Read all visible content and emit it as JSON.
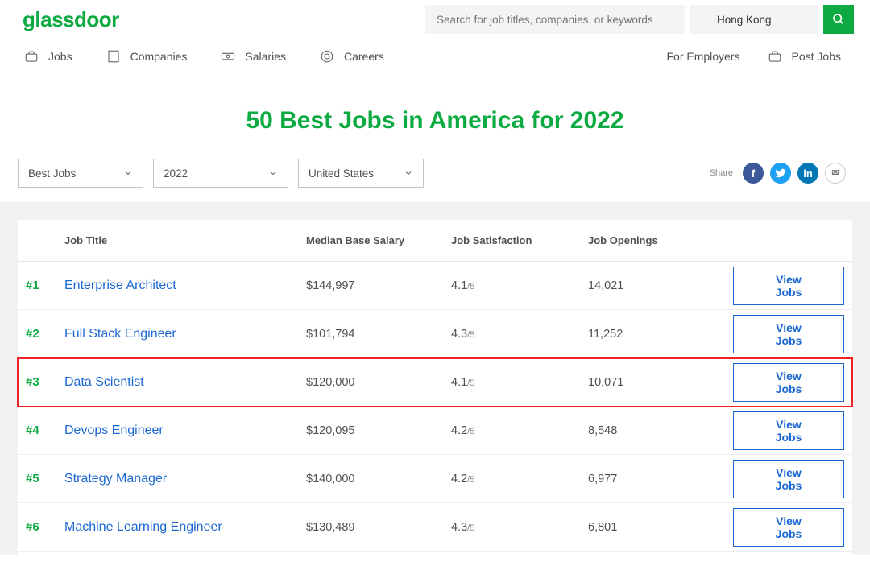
{
  "brand": "glassdoor",
  "search": {
    "placeholder_jobs": "Search for job titles, companies, or keywords",
    "placeholder_location": "",
    "location_value": "Hong Kong"
  },
  "nav": {
    "jobs": "Jobs",
    "companies": "Companies",
    "salaries": "Salaries",
    "careers": "Careers",
    "for_employers": "For Employers",
    "post_jobs": "Post Jobs"
  },
  "page_title": "50 Best Jobs in America for 2022",
  "filters": {
    "type": "Best Jobs",
    "year": "2022",
    "country": "United States"
  },
  "share_label": "Share",
  "table": {
    "headers": {
      "job_title": "Job Title",
      "salary": "Median Base Salary",
      "satisfaction": "Job Satisfaction",
      "openings": "Job Openings"
    },
    "view_jobs_label": "View Jobs",
    "sat_denominator": "/5",
    "rows": [
      {
        "rank": "#1",
        "title": "Enterprise Architect",
        "salary": "$144,997",
        "sat": "4.1",
        "openings": "14,021",
        "highlight": false
      },
      {
        "rank": "#2",
        "title": "Full Stack Engineer",
        "salary": "$101,794",
        "sat": "4.3",
        "openings": "11,252",
        "highlight": false
      },
      {
        "rank": "#3",
        "title": "Data Scientist",
        "salary": "$120,000",
        "sat": "4.1",
        "openings": "10,071",
        "highlight": true
      },
      {
        "rank": "#4",
        "title": "Devops Engineer",
        "salary": "$120,095",
        "sat": "4.2",
        "openings": "8,548",
        "highlight": false
      },
      {
        "rank": "#5",
        "title": "Strategy Manager",
        "salary": "$140,000",
        "sat": "4.2",
        "openings": "6,977",
        "highlight": false
      },
      {
        "rank": "#6",
        "title": "Machine Learning Engineer",
        "salary": "$130,489",
        "sat": "4.3",
        "openings": "6,801",
        "highlight": false
      }
    ]
  }
}
